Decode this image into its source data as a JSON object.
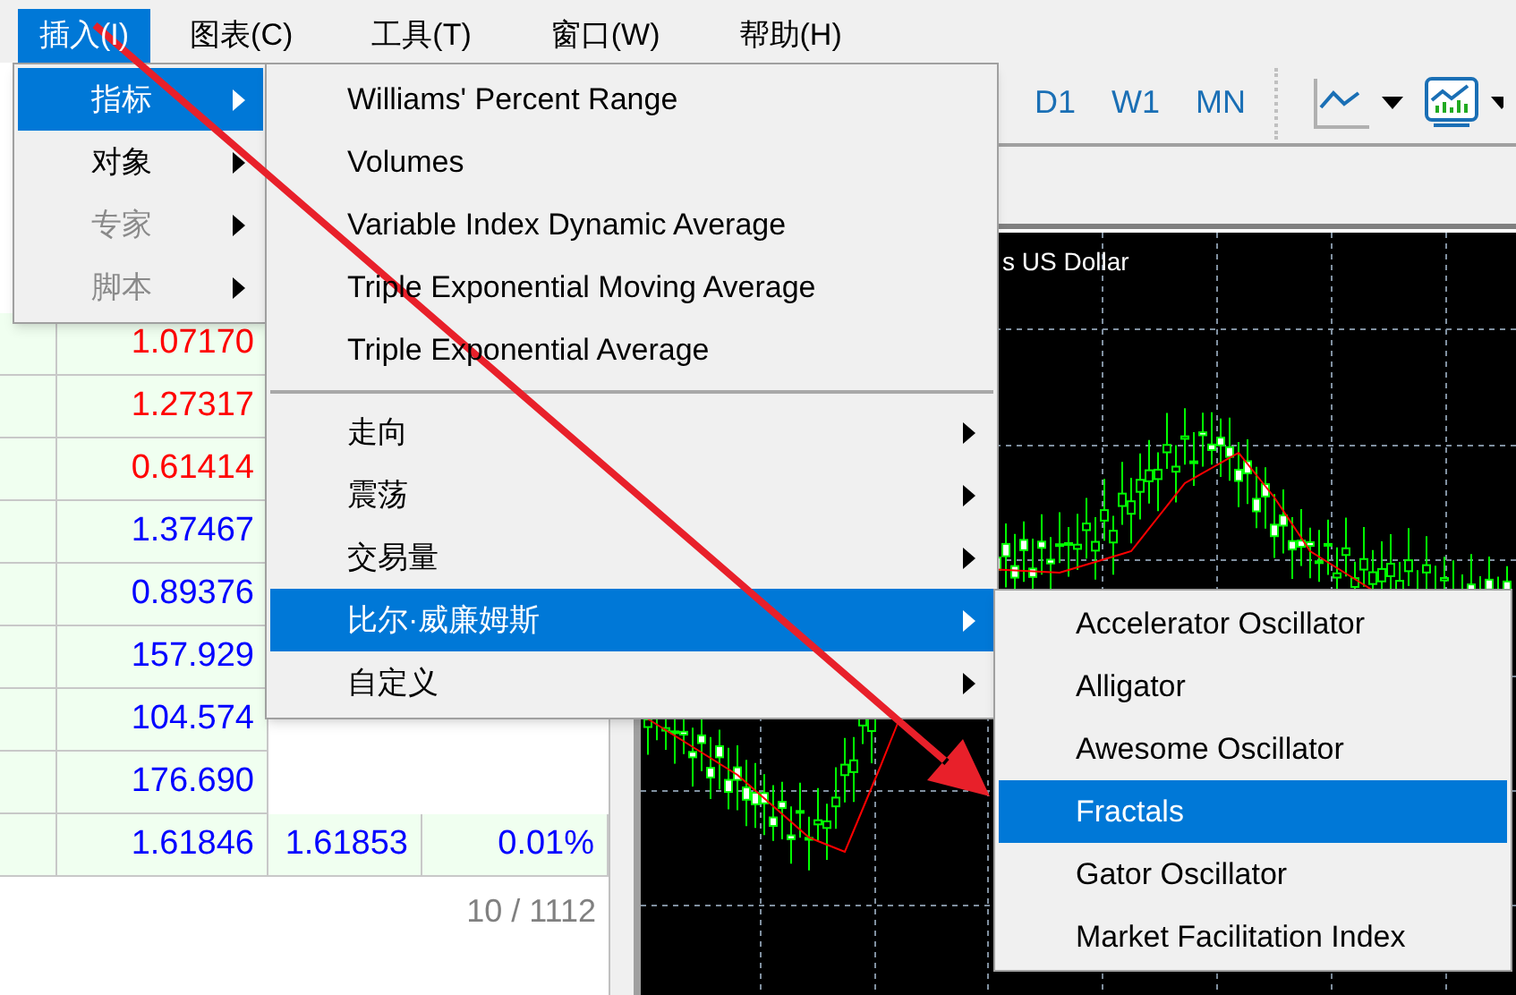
{
  "menubar": [
    {
      "label": "插入(I)",
      "selected": true
    },
    {
      "label": "图表(C)",
      "selected": false
    },
    {
      "label": "工具(T)",
      "selected": false
    },
    {
      "label": "窗口(W)",
      "selected": false
    },
    {
      "label": "帮助(H)",
      "selected": false
    }
  ],
  "toolbar": {
    "timeframes": [
      {
        "label": "D1"
      },
      {
        "label": "W1"
      },
      {
        "label": "MN"
      }
    ]
  },
  "market_watch": {
    "rows": [
      {
        "bid": "1.07170",
        "color": "#ff0000"
      },
      {
        "bid": "1.27317",
        "color": "#ff0000"
      },
      {
        "bid": "0.61414",
        "color": "#ff0000"
      },
      {
        "bid": "1.37467",
        "color": "#0000ff"
      },
      {
        "bid": "0.89376",
        "color": "#0000ff"
      },
      {
        "bid": "157.929",
        "color": "#0000ff"
      },
      {
        "bid": "104.574",
        "color": "#0000ff"
      },
      {
        "bid": "176.690",
        "color": "#0000ff"
      },
      {
        "bid": "1.61846",
        "ask": "1.61853",
        "change": "0.01%",
        "color": "#0000ff"
      }
    ],
    "footer": "10 / 1112"
  },
  "chart": {
    "title": "s US Dollar"
  },
  "menus": [
    {
      "items": [
        {
          "kind": "item",
          "label": "指标",
          "selected": true,
          "disabled": false,
          "submenu": true
        },
        {
          "kind": "item",
          "label": "对象",
          "selected": false,
          "disabled": false,
          "submenu": true
        },
        {
          "kind": "item",
          "label": "专家",
          "selected": false,
          "disabled": true,
          "submenu": true
        },
        {
          "kind": "item",
          "label": "脚本",
          "selected": false,
          "disabled": true,
          "submenu": true
        }
      ]
    },
    {
      "items": [
        {
          "kind": "item",
          "label": "Williams' Percent Range",
          "selected": false,
          "disabled": false,
          "submenu": false
        },
        {
          "kind": "item",
          "label": "Volumes",
          "selected": false,
          "disabled": false,
          "submenu": false
        },
        {
          "kind": "item",
          "label": "Variable Index Dynamic Average",
          "selected": false,
          "disabled": false,
          "submenu": false
        },
        {
          "kind": "item",
          "label": "Triple Exponential Moving Average",
          "selected": false,
          "disabled": false,
          "submenu": false
        },
        {
          "kind": "item",
          "label": "Triple Exponential Average",
          "selected": false,
          "disabled": false,
          "submenu": false
        },
        {
          "kind": "separator"
        },
        {
          "kind": "item",
          "label": "走向",
          "selected": false,
          "disabled": false,
          "submenu": true
        },
        {
          "kind": "item",
          "label": "震荡",
          "selected": false,
          "disabled": false,
          "submenu": true
        },
        {
          "kind": "item",
          "label": "交易量",
          "selected": false,
          "disabled": false,
          "submenu": true
        },
        {
          "kind": "item",
          "label": "比尔·威廉姆斯",
          "selected": true,
          "disabled": false,
          "submenu": true
        },
        {
          "kind": "item",
          "label": "自定义",
          "selected": false,
          "disabled": false,
          "submenu": true
        }
      ]
    },
    {
      "items": [
        {
          "kind": "item",
          "label": "Accelerator Oscillator",
          "selected": false,
          "disabled": false,
          "submenu": false
        },
        {
          "kind": "item",
          "label": "Alligator",
          "selected": false,
          "disabled": false,
          "submenu": false
        },
        {
          "kind": "item",
          "label": "Awesome Oscillator",
          "selected": false,
          "disabled": false,
          "submenu": false
        },
        {
          "kind": "item",
          "label": "Fractals",
          "selected": true,
          "disabled": false,
          "submenu": false
        },
        {
          "kind": "item",
          "label": "Gator Oscillator",
          "selected": false,
          "disabled": false,
          "submenu": false
        },
        {
          "kind": "item",
          "label": "Market Facilitation Index",
          "selected": false,
          "disabled": false,
          "submenu": false
        }
      ]
    }
  ]
}
